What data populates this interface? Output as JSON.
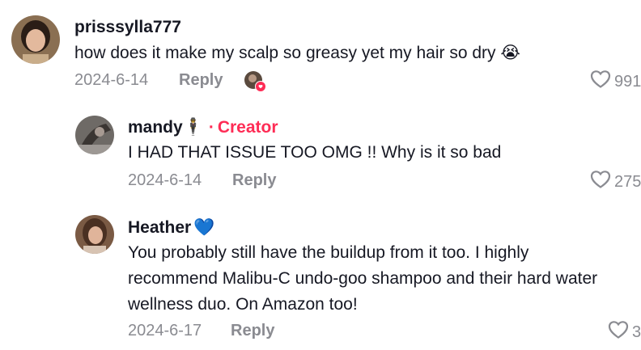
{
  "comments": [
    {
      "username": "prisssylla777",
      "text": "how does it make my scalp so greasy yet my hair so dry",
      "emoji": "😭",
      "date": "2024-6-14",
      "reply_label": "Reply",
      "likes": "991"
    },
    {
      "username": "mandy",
      "name_symbol": "🕴",
      "creator_label": "Creator",
      "separator": "·",
      "text": "I HAD THAT ISSUE TOO OMG !! Why is it so bad",
      "date": "2024-6-14",
      "reply_label": "Reply",
      "likes": "275"
    },
    {
      "username": "Heather",
      "name_emoji": "💙",
      "text_lines": [
        "You probably still have the buildup from it too. I highly",
        "recommend Malibu-C undo-goo shampoo and their hard water",
        "wellness duo. On Amazon too!"
      ],
      "date": "2024-6-17",
      "reply_label": "Reply",
      "likes": "3"
    }
  ],
  "colors": {
    "creator": "#fe2c55",
    "meta": "#8a8b91",
    "text": "#161823"
  }
}
